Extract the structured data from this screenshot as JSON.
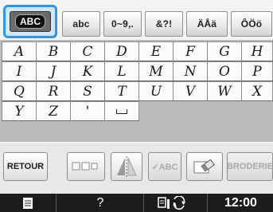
{
  "tabs": [
    {
      "label": "ABC",
      "selected": true
    },
    {
      "label": "abc",
      "selected": false
    },
    {
      "label": "0~9,.",
      "selected": false
    },
    {
      "label": "&?!",
      "selected": false
    },
    {
      "label": "ÄÅä",
      "selected": false
    },
    {
      "label": "ÔÖö",
      "selected": false
    }
  ],
  "keys": [
    "A",
    "B",
    "C",
    "D",
    "E",
    "F",
    "G",
    "H",
    "I",
    "J",
    "K",
    "L",
    "M",
    "N",
    "O",
    "P",
    "Q",
    "R",
    "S",
    "T",
    "U",
    "V",
    "W",
    "X",
    "Y",
    "Z",
    "'"
  ],
  "toolbar": {
    "back_label": "RETOUR",
    "check_label": "✓ABC",
    "embroidery_label": "BRODERIE"
  },
  "status": {
    "help": "?",
    "clock": "12:00"
  },
  "colors": {
    "selection_highlight": "#2f95e8",
    "status_bar": "#1c1c1c"
  }
}
